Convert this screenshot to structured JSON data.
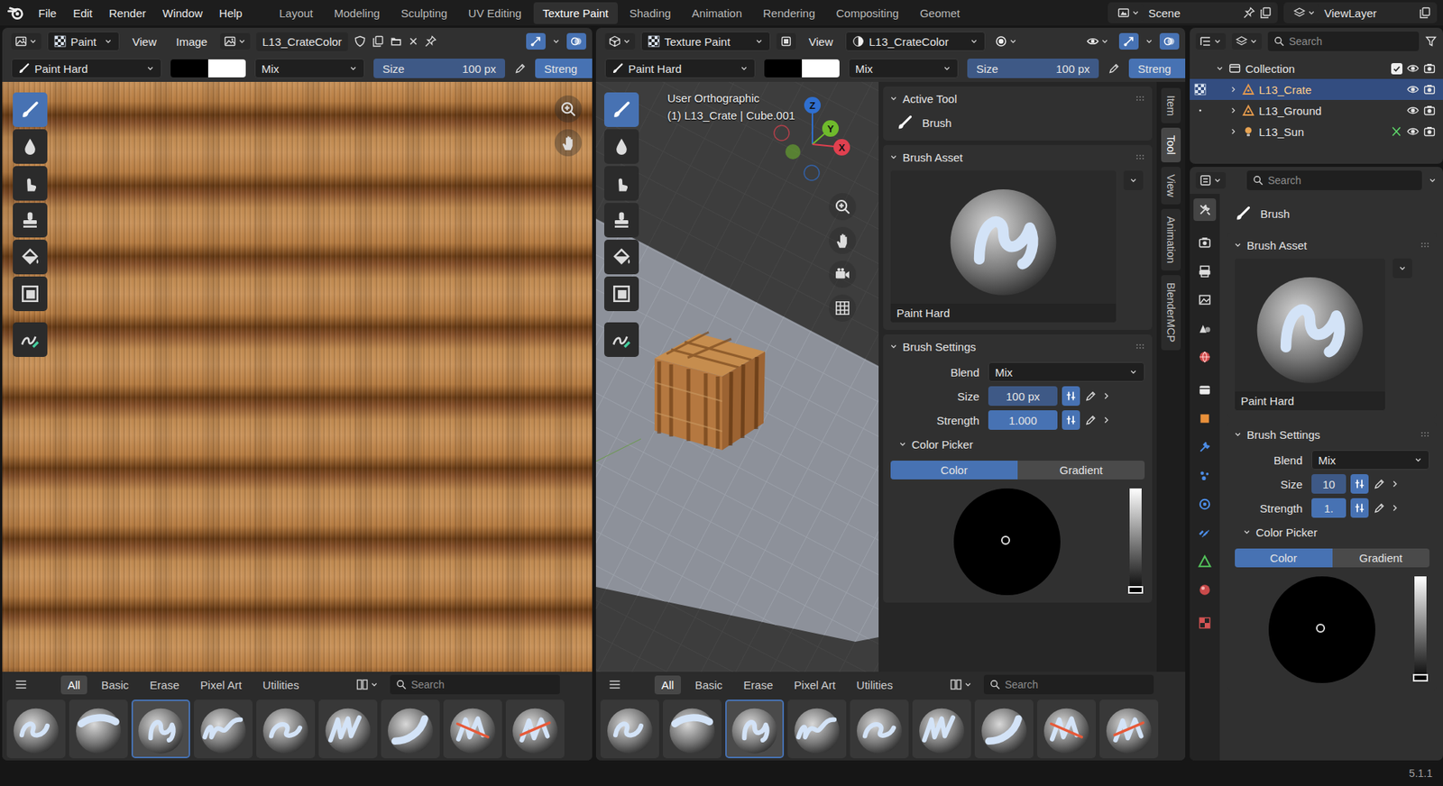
{
  "topbar": {
    "menus": [
      "File",
      "Edit",
      "Render",
      "Window",
      "Help"
    ],
    "workspaces": [
      {
        "label": "Layout",
        "selected": false
      },
      {
        "label": "Modeling",
        "selected": false
      },
      {
        "label": "Sculpting",
        "selected": false
      },
      {
        "label": "UV Editing",
        "selected": false
      },
      {
        "label": "Texture Paint",
        "selected": true
      },
      {
        "label": "Shading",
        "selected": false
      },
      {
        "label": "Animation",
        "selected": false
      },
      {
        "label": "Rendering",
        "selected": false
      },
      {
        "label": "Compositing",
        "selected": false
      },
      {
        "label": "Geomet",
        "selected": false
      }
    ],
    "scene": "Scene",
    "view_layer": "ViewLayer"
  },
  "image_editor": {
    "header": {
      "mode": "Paint",
      "menus": [
        "View",
        "Image"
      ],
      "image": "L13_CrateColor"
    },
    "tool_settings": {
      "brush": "Paint Hard",
      "blend": "Mix",
      "size_label": "Size",
      "size": "100 px",
      "strength_label": "Streng"
    },
    "tools": [
      {
        "selected": true
      },
      {
        "selected": false
      },
      {
        "selected": false
      },
      {
        "selected": false
      },
      {
        "selected": false
      },
      {
        "selected": false
      },
      {
        "selected": false
      }
    ],
    "shelf": {
      "tabs": [
        {
          "label": "All",
          "selected": true
        },
        {
          "label": "Basic",
          "selected": false
        },
        {
          "label": "Erase",
          "selected": false
        },
        {
          "label": "Pixel Art",
          "selected": false
        },
        {
          "label": "Utilities",
          "selected": false
        }
      ],
      "search_placeholder": "Search",
      "brushes": [
        {
          "selected": false
        },
        {
          "selected": false
        },
        {
          "selected": true
        },
        {
          "selected": false
        },
        {
          "selected": false
        },
        {
          "selected": false
        },
        {
          "selected": false
        },
        {
          "selected": false
        },
        {
          "selected": false
        }
      ]
    }
  },
  "viewport": {
    "header": {
      "mode": "Texture Paint",
      "menus": [
        "View"
      ],
      "image": "L13_CrateColor"
    },
    "tool_settings": {
      "brush": "Paint Hard",
      "blend": "Mix",
      "size_label": "Size",
      "size": "100 px",
      "strength_label": "Streng"
    },
    "tools": [
      {
        "selected": true
      },
      {
        "selected": false
      },
      {
        "selected": false
      },
      {
        "selected": false
      },
      {
        "selected": false
      },
      {
        "selected": false
      },
      {
        "selected": false
      }
    ],
    "overlay": {
      "view": "User Orthographic",
      "object": "(1) L13_Crate | Cube.001"
    },
    "gizmo": [
      {
        "label": "Z",
        "color": "#2f6fd0"
      },
      {
        "label": "Y",
        "color": "#6fba2c"
      },
      {
        "label": "X",
        "color": "#e0404f"
      }
    ],
    "sidebar_tabs": [
      {
        "label": "Item",
        "selected": false
      },
      {
        "label": "Tool",
        "selected": true
      },
      {
        "label": "View",
        "selected": false
      },
      {
        "label": "Animation",
        "selected": false
      },
      {
        "label": "BlenderMCP",
        "selected": false
      }
    ],
    "sidebar": {
      "active_tool": {
        "title": "Active Tool",
        "expanded": true,
        "tool": "Brush"
      },
      "brush_asset": {
        "title": "Brush Asset",
        "expanded": true,
        "name": "Paint Hard"
      },
      "brush_settings": {
        "title": "Brush Settings",
        "expanded": true,
        "blend_label": "Blend",
        "blend": "Mix",
        "size_label": "Size",
        "size": "100 px",
        "strength_label": "Strength",
        "strength": "1.000",
        "strength_level": 1
      },
      "color_picker": {
        "title": "Color Picker",
        "expanded": true,
        "tabs": [
          {
            "label": "Color",
            "selected": true
          },
          {
            "label": "Gradient",
            "selected": false
          }
        ],
        "value_level": 0
      }
    },
    "shelf": {
      "tabs": [
        {
          "label": "All",
          "selected": true
        },
        {
          "label": "Basic",
          "selected": false
        },
        {
          "label": "Erase",
          "selected": false
        },
        {
          "label": "Pixel Art",
          "selected": false
        },
        {
          "label": "Utilities",
          "selected": false
        }
      ],
      "search_placeholder": "Search",
      "brushes": [
        {
          "selected": false
        },
        {
          "selected": false
        },
        {
          "selected": true
        },
        {
          "selected": false
        },
        {
          "selected": false
        },
        {
          "selected": false
        },
        {
          "selected": false
        },
        {
          "selected": false
        },
        {
          "selected": false
        }
      ]
    }
  },
  "outliner": {
    "search_placeholder": "Search",
    "collection": {
      "label": "Collection",
      "expanded": true,
      "checked": true
    },
    "items": [
      {
        "label": "L13_Crate",
        "kind": "mesh",
        "selected": true,
        "expanded": false
      },
      {
        "label": "L13_Ground",
        "kind": "mesh",
        "selected": false,
        "expanded": false
      },
      {
        "label": "L13_Sun",
        "kind": "light",
        "selected": false,
        "expanded": false
      }
    ]
  },
  "properties": {
    "search_placeholder": "Search",
    "tabs": [
      {
        "selected": true
      },
      {
        "selected": false
      },
      {
        "selected": false
      },
      {
        "selected": false
      },
      {
        "selected": false
      },
      {
        "selected": false
      },
      {
        "selected": false
      },
      {
        "selected": false
      },
      {
        "selected": false
      },
      {
        "selected": false
      },
      {
        "selected": false
      },
      {
        "selected": false
      },
      {
        "selected": false
      },
      {
        "selected": false
      },
      {
        "selected": false
      }
    ],
    "tool": "Brush",
    "brush_asset": {
      "title": "Brush Asset",
      "expanded": true,
      "name": "Paint Hard"
    },
    "brush_settings": {
      "title": "Brush Settings",
      "expanded": true,
      "blend_label": "Blend",
      "blend": "Mix",
      "size_label": "Size",
      "size": "10",
      "strength_label": "Strength",
      "strength": "1.",
      "strength_level": 1
    },
    "color_picker": {
      "title": "Color Picker",
      "expanded": true,
      "tabs": [
        {
          "label": "Color",
          "selected": true
        },
        {
          "label": "Gradient",
          "selected": false
        }
      ],
      "value_level": 0
    }
  },
  "status_bar": {
    "version": "5.1.1"
  }
}
